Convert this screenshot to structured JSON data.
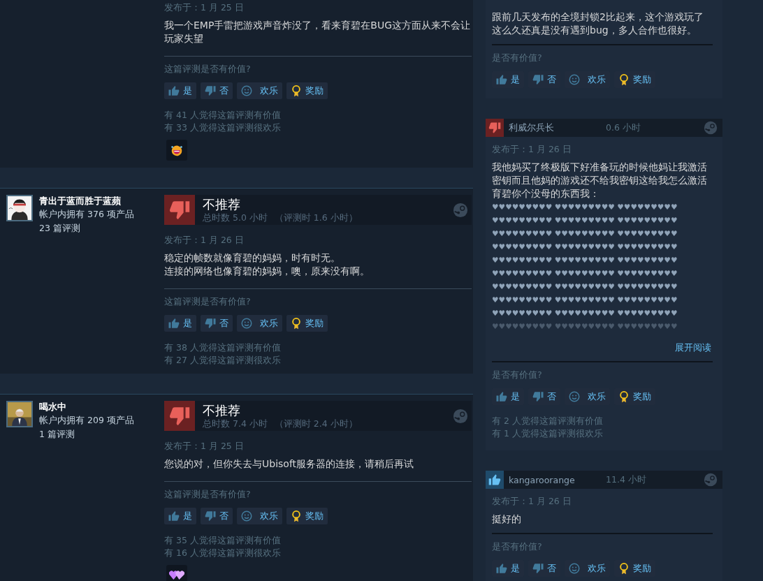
{
  "reviews": [
    {
      "date": "发布于：1 月 25 日",
      "paragraphs": [
        "我一个EMP手雷把游戏声音炸没了，看来育碧在BUG这方面从来不会让玩家失望"
      ],
      "helpful_prompt": "这篇评测是否有价值?",
      "buttons": [
        {
          "kind": "yes",
          "label": "是"
        },
        {
          "kind": "no",
          "label": "否"
        },
        {
          "kind": "funny",
          "label": "欢乐"
        },
        {
          "kind": "award",
          "label": "奖励"
        }
      ],
      "counts": [
        "有 41 人觉得这篇评测有价值",
        "有 33 人觉得这篇评测很欢乐"
      ],
      "award": {
        "kind": "laugh"
      }
    },
    {
      "author": {
        "name": "青出于蓝而胜于蓝蘋",
        "products": "帐户内拥有 376 项产品",
        "reviews": "23 篇评测"
      },
      "verdict": {
        "recommended": false,
        "label": "不推荐",
        "total": "总时数 5.0 小时",
        "at_review": "（评测时 1.6 小时）"
      },
      "date": "发布于：1 月 26 日",
      "paragraphs": [
        "稳定的帧数就像育碧的妈妈，时有时无。",
        "连接的网络也像育碧的妈妈，噢，原来没有啊。"
      ],
      "helpful_prompt": "这篇评测是否有价值?",
      "buttons": [
        {
          "kind": "yes",
          "label": "是"
        },
        {
          "kind": "no",
          "label": "否"
        },
        {
          "kind": "funny",
          "label": "欢乐"
        },
        {
          "kind": "award",
          "label": "奖励"
        }
      ],
      "counts": [
        "有 38 人觉得这篇评测有价值",
        "有 27 人觉得这篇评测很欢乐"
      ]
    },
    {
      "author": {
        "name": "喝水中",
        "products": "帐户内拥有 209 项产品",
        "reviews": "1 篇评测"
      },
      "verdict": {
        "recommended": false,
        "label": "不推荐",
        "total": "总时数 7.4 小时",
        "at_review": "（评测时 2.4 小时）"
      },
      "date": "发布于：1 月 25 日",
      "paragraphs": [
        "您说的对，但你失去与Ubisoft服务器的连接，请稍后再试"
      ],
      "helpful_prompt": "这篇评测是否有价值?",
      "buttons": [
        {
          "kind": "yes",
          "label": "是"
        },
        {
          "kind": "no",
          "label": "否"
        },
        {
          "kind": "funny",
          "label": "欢乐"
        },
        {
          "kind": "award",
          "label": "奖励"
        }
      ],
      "counts": [
        "有 35 人觉得这篇评测有价值",
        "有 16 人觉得这篇评测很欢乐"
      ],
      "award": {
        "kind": "hearts"
      }
    }
  ],
  "side_reviews": [
    {
      "paragraphs": [
        "跟前几天发布的全境封锁2比起来，这个游戏玩了这么久还真是没有遇到bug，多人合作也很好。"
      ],
      "collapsed": false,
      "helpful_prompt": "是否有价值?",
      "buttons": [
        {
          "kind": "yes",
          "label": "是"
        },
        {
          "kind": "no",
          "label": "否"
        },
        {
          "kind": "funny",
          "label": "欢乐"
        },
        {
          "kind": "award",
          "label": "奖励"
        }
      ]
    },
    {
      "header": {
        "recommended": false,
        "name": "利威尔兵长",
        "hours": "0.6 小时"
      },
      "date": "发布于：1 月 26 日",
      "paragraphs": [
        "我他妈买了终极版下好准备玩的时候他妈让我激活密钥而且他妈的游戏还不给我密钥这给我怎么激活育碧你个没母的东西我：",
        "♥♥♥♥♥♥♥♥♥ ♥♥♥♥♥♥♥♥♥ ♥♥♥♥♥♥♥♥♥",
        "♥♥♥♥♥♥♥♥♥ ♥♥♥♥♥♥♥♥♥ ♥♥♥♥♥♥♥♥♥",
        "♥♥♥♥♥♥♥♥♥ ♥♥♥♥♥♥♥♥♥ ♥♥♥♥♥♥♥♥♥",
        "♥♥♥♥♥♥♥♥♥ ♥♥♥♥♥♥♥♥♥ ♥♥♥♥♥♥♥♥♥",
        "♥♥♥♥♥♥♥♥♥ ♥♥♥♥♥♥♥♥♥ ♥♥♥♥♥♥♥♥♥",
        "♥♥♥♥♥♥♥♥♥ ♥♥♥♥♥♥♥♥♥ ♥♥♥♥♥♥♥♥♥",
        "♥♥♥♥♥♥♥♥♥ ♥♥♥♥♥♥♥♥♥ ♥♥♥♥♥♥♥♥♥",
        "♥♥♥♥♥♥♥♥♥ ♥♥♥♥♥♥♥♥♥ ♥♥♥♥♥♥♥♥♥",
        "♥♥♥♥♥♥♥♥♥ ♥♥♥♥♥♥♥♥♥ ♥♥♥♥♥♥♥♥♥",
        "♥♥♥♥♥♥♥♥♥ ♥♥♥♥♥♥♥♥♥ ♥♥♥♥♥♥♥♥♥"
      ],
      "collapsed": true,
      "expand_link": "展开阅读",
      "helpful_prompt": "是否有价值?",
      "buttons": [
        {
          "kind": "yes",
          "label": "是"
        },
        {
          "kind": "no",
          "label": "否"
        },
        {
          "kind": "funny",
          "label": "欢乐"
        },
        {
          "kind": "award",
          "label": "奖励"
        }
      ],
      "counts": [
        "有 2 人觉得这篇评测有价值",
        "有 1 人觉得这篇评测很欢乐"
      ]
    },
    {
      "header": {
        "recommended": true,
        "name": "kangaroorange",
        "hours": "11.4 小时"
      },
      "date": "发布于：1 月 26 日",
      "paragraphs": [
        "挺好的"
      ],
      "collapsed": false,
      "helpful_prompt": "是否有价值?",
      "buttons": [
        {
          "kind": "yes",
          "label": "是"
        },
        {
          "kind": "no",
          "label": "否"
        },
        {
          "kind": "funny",
          "label": "欢乐"
        },
        {
          "kind": "award",
          "label": "奖励"
        }
      ]
    }
  ]
}
